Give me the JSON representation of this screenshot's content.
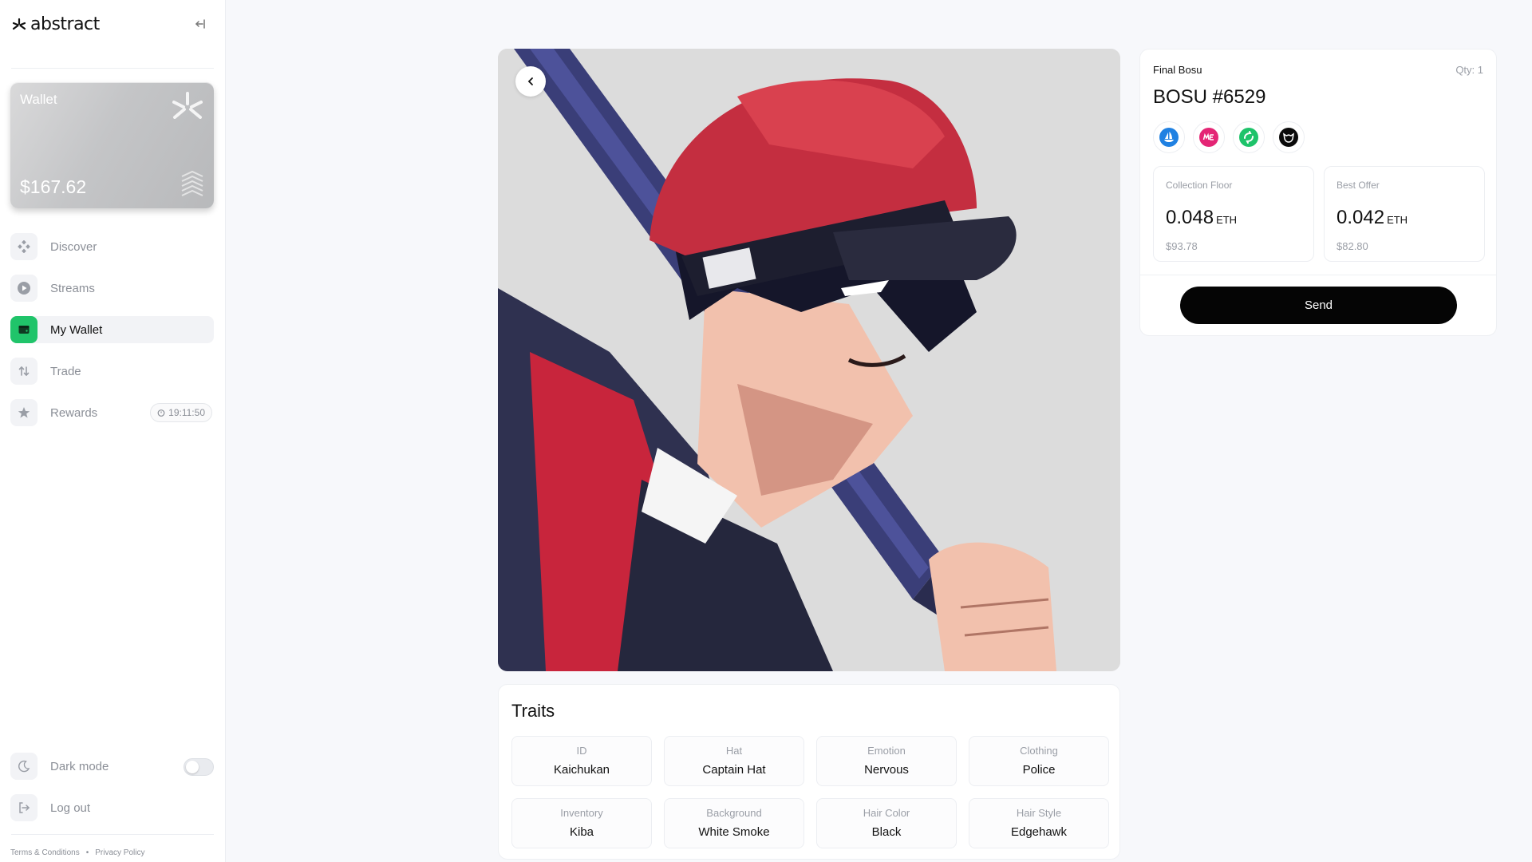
{
  "app": {
    "logo_text": "abstract"
  },
  "wallet": {
    "label": "Wallet",
    "balance": "$167.62"
  },
  "nav": {
    "items": [
      {
        "label": "Discover",
        "icon": "diamond-grid-icon",
        "active": false
      },
      {
        "label": "Streams",
        "icon": "play-icon",
        "active": false
      },
      {
        "label": "My Wallet",
        "icon": "wallet-icon",
        "active": true
      },
      {
        "label": "Trade",
        "icon": "swap-icon",
        "active": false
      },
      {
        "label": "Rewards",
        "icon": "star-icon",
        "active": false,
        "badge": "19:11:50"
      }
    ],
    "bottom": [
      {
        "label": "Dark mode",
        "icon": "moon-icon",
        "toggle": false
      },
      {
        "label": "Log out",
        "icon": "logout-icon"
      }
    ]
  },
  "footer": {
    "terms": "Terms & Conditions",
    "separator": "•",
    "privacy": "Privacy Policy"
  },
  "nft": {
    "collection": "Final Bosu",
    "qty": "Qty: 1",
    "name": "BOSU #6529",
    "marketplaces": [
      "opensea-icon",
      "magiceden-icon",
      "swap-market-icon",
      "cat-market-icon"
    ],
    "collection_floor": {
      "label": "Collection Floor",
      "value": "0.048",
      "unit": "ETH",
      "usd": "$93.78"
    },
    "best_offer": {
      "label": "Best Offer",
      "value": "0.042",
      "unit": "ETH",
      "usd": "$82.80"
    },
    "send_label": "Send"
  },
  "traits": {
    "title": "Traits",
    "items": [
      {
        "type": "ID",
        "value": "Kaichukan"
      },
      {
        "type": "Hat",
        "value": "Captain Hat"
      },
      {
        "type": "Emotion",
        "value": "Nervous"
      },
      {
        "type": "Clothing",
        "value": "Police"
      },
      {
        "type": "Inventory",
        "value": "Kiba"
      },
      {
        "type": "Background",
        "value": "White Smoke"
      },
      {
        "type": "Hair Color",
        "value": "Black"
      },
      {
        "type": "Hair Style",
        "value": "Edgehawk"
      }
    ]
  },
  "colors": {
    "accent_green": "#20c46a",
    "send_bg": "#050505",
    "art_background": "#dcdcdc"
  }
}
